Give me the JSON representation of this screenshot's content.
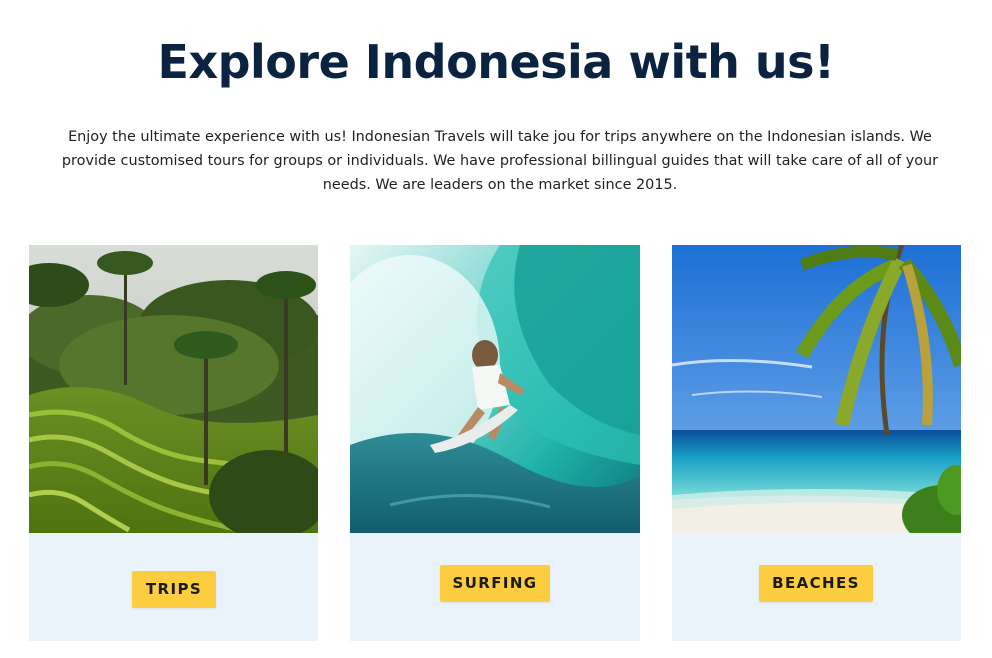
{
  "header": {
    "title": "Explore Indonesia with us!",
    "intro": "Enjoy the ultimate experience with us! Indonesian Travels will take jou for trips anywhere on the Indonesian islands. We provide customised tours for groups or individuals. We have professional billingual guides that will take care of all of your needs. We are leaders on the market since 2015."
  },
  "cards": [
    {
      "label": "TRIPS",
      "image": "rice-terraces-photo"
    },
    {
      "label": "SURFING",
      "image": "surfer-wave-photo"
    },
    {
      "label": "BEACHES",
      "image": "tropical-beach-photo"
    }
  ],
  "colors": {
    "title": "#0b2340",
    "card_background": "#ebf3fa",
    "button": "#fbcd3f"
  }
}
